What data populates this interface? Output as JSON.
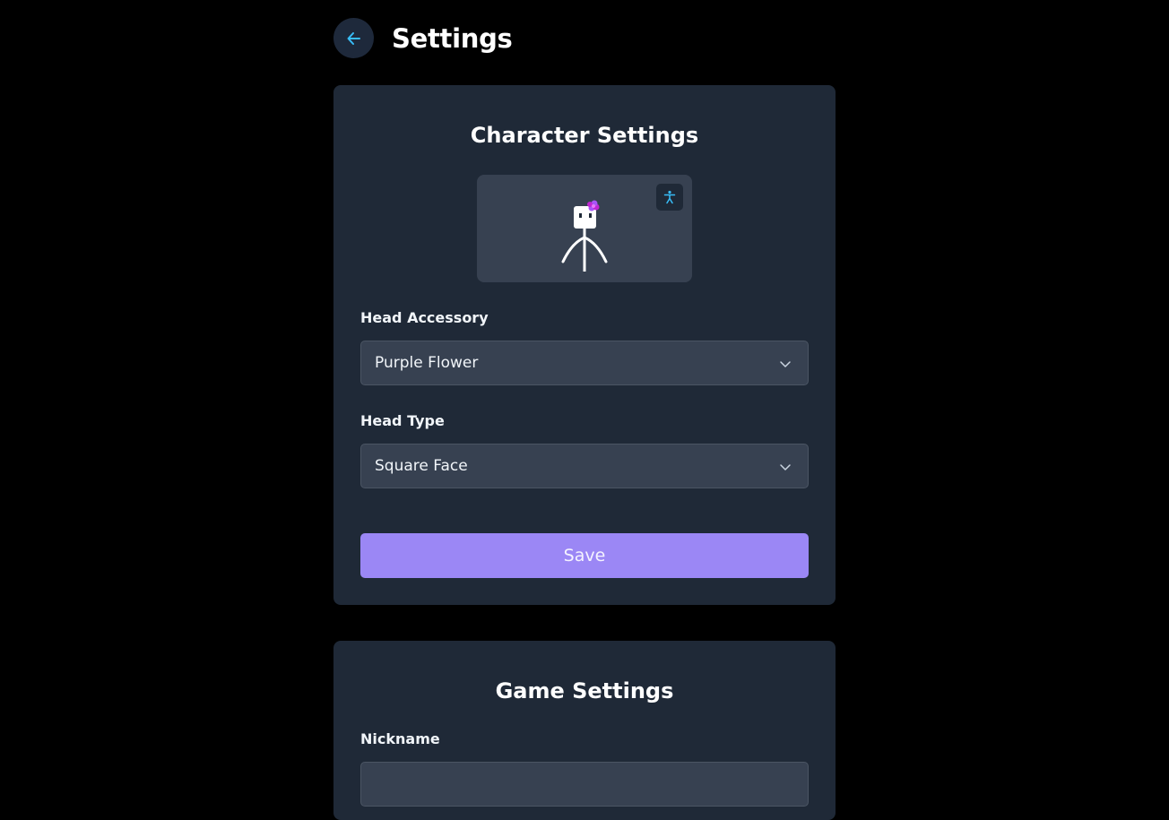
{
  "header": {
    "title": "Settings",
    "back_icon": "arrow-left-icon"
  },
  "character_settings": {
    "title": "Character Settings",
    "preview_toggle_icon": "accessibility-icon",
    "head_accessory": {
      "label": "Head Accessory",
      "value": "Purple Flower"
    },
    "head_type": {
      "label": "Head Type",
      "value": "Square Face"
    },
    "save_label": "Save"
  },
  "game_settings": {
    "title": "Game Settings",
    "nickname": {
      "label": "Nickname",
      "value": ""
    }
  },
  "colors": {
    "background": "#000000",
    "card": "#1f2937",
    "field": "#374151",
    "accent": "#9b87f5",
    "icon_blue": "#38bdf8",
    "flower_purple": "#c026d3"
  }
}
